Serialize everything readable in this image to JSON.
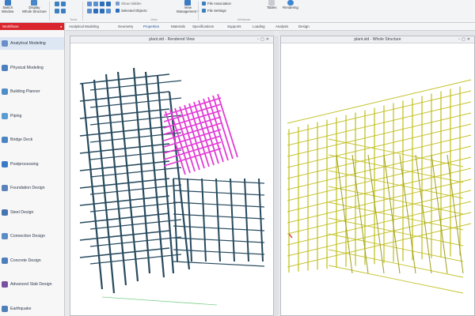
{
  "ribbon": {
    "buttons": [
      {
        "line1": "Switch",
        "line2": "Window",
        "icon": "window-icon"
      },
      {
        "line1": "Display",
        "line2": "Whole Structure",
        "icon": "structure-icon"
      }
    ],
    "small_tools": [
      "Show Hidden",
      "Selected Objects"
    ],
    "view_management": {
      "line1": "View",
      "line2": "Management ▾"
    },
    "file_items": [
      "File Association",
      "File Settings"
    ],
    "right_labels": {
      "tables": "Tables",
      "rendering": "Rendering"
    },
    "groups": [
      "Tools",
      "View",
      "Windows"
    ]
  },
  "sidebar": {
    "header": "Workflows",
    "items": [
      {
        "label": "Analytical Modeling",
        "icon": "analytical-modeling-icon",
        "color": "#6a8fc7"
      },
      {
        "label": "Physical Modeling",
        "icon": "physical-modeling-icon",
        "color": "#4e7fbf"
      },
      {
        "label": "Building Planner",
        "icon": "building-planner-icon",
        "color": "#4f8dc9"
      },
      {
        "label": "Piping",
        "icon": "piping-icon",
        "color": "#5a9bd4"
      },
      {
        "label": "Bridge Deck",
        "icon": "bridge-deck-icon",
        "color": "#4b86c2"
      },
      {
        "label": "Postprocessing",
        "icon": "postprocessing-icon",
        "color": "#3b79c6"
      },
      {
        "label": "Foundation Design",
        "icon": "foundation-design-icon",
        "color": "#5b82b8"
      },
      {
        "label": "Steel Design",
        "icon": "steel-design-icon",
        "color": "#4674b0"
      },
      {
        "label": "Connection Design",
        "icon": "connection-design-icon",
        "color": "#5a8cc5"
      },
      {
        "label": "Concrete Design",
        "icon": "concrete-design-icon",
        "color": "#4d7fbd"
      },
      {
        "label": "Advanced Slab Design",
        "icon": "advanced-slab-design-icon",
        "color": "#7b4fa0"
      },
      {
        "label": "Earthquake",
        "icon": "earthquake-icon",
        "color": "#4f7fb8"
      }
    ]
  },
  "tabs": [
    "Analytical Modeling",
    "Geometry",
    "Properties",
    "Materials",
    "Specifications",
    "Supports",
    "Loading",
    "Analysis",
    "Design"
  ],
  "active_tab": "Properties",
  "viewports": {
    "left_title": "plant.std - Rendered View",
    "right_title": "plant.std - Whole Structure"
  },
  "colors": {
    "accent_red": "#d9262c",
    "steel_rendered": "#274a5e",
    "highlight": "#e23ad6",
    "wireframe": "#c4c22a"
  }
}
